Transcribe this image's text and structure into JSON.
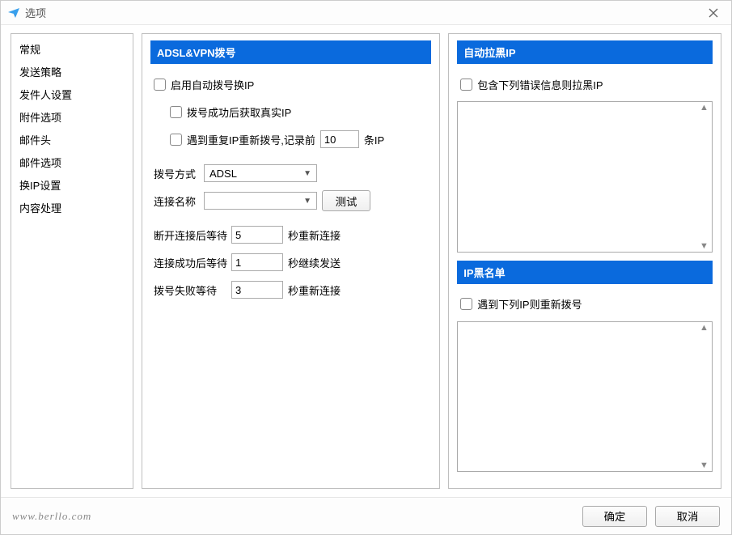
{
  "window": {
    "title": "选项"
  },
  "sidebar": {
    "items": [
      {
        "label": "常规"
      },
      {
        "label": "发送策略"
      },
      {
        "label": "发件人设置"
      },
      {
        "label": "附件选项"
      },
      {
        "label": "邮件头"
      },
      {
        "label": "邮件选项"
      },
      {
        "label": "换IP设置"
      },
      {
        "label": "内容处理"
      }
    ]
  },
  "adsl": {
    "header": "ADSL&VPN拨号",
    "enable_label": "启用自动拨号换IP",
    "get_real_ip_label": "拨号成功后获取真实IP",
    "dup_ip_prefix": "遇到重复IP重新拨号,记录前",
    "dup_ip_value": "10",
    "dup_ip_suffix": "条IP",
    "dial_method_label": "拨号方式",
    "dial_method_value": "ADSL",
    "conn_name_label": "连接名称",
    "conn_name_value": "",
    "test_button": "测试",
    "disconnect_wait_label": "断开连接后等待",
    "disconnect_wait_value": "5",
    "disconnect_wait_suffix": "秒重新连接",
    "conn_success_wait_label": "连接成功后等待",
    "conn_success_wait_value": "1",
    "conn_success_wait_suffix": "秒继续发送",
    "dial_fail_wait_label": "拨号失败等待",
    "dial_fail_wait_value": "3",
    "dial_fail_wait_suffix": "秒重新连接"
  },
  "auto_block": {
    "header": "自动拉黑IP",
    "checkbox_label": "包含下列错误信息则拉黑IP"
  },
  "ip_blacklist": {
    "header": "IP黑名单",
    "checkbox_label": "遇到下列IP则重新拨号"
  },
  "footer": {
    "link": "www.berllo.com",
    "ok": "确定",
    "cancel": "取消"
  }
}
